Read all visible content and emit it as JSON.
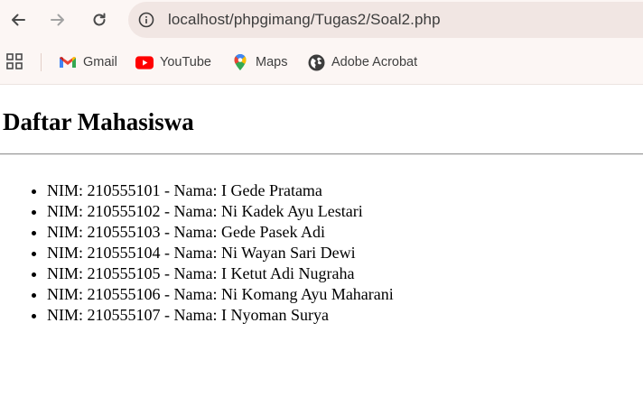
{
  "browser": {
    "url": "localhost/phpgimang/Tugas2/Soal2.php",
    "bookmarks": [
      {
        "label": "Gmail",
        "icon": "gmail-icon"
      },
      {
        "label": "YouTube",
        "icon": "youtube-icon"
      },
      {
        "label": "Maps",
        "icon": "maps-icon"
      },
      {
        "label": "Adobe Acrobat",
        "icon": "globe-icon"
      }
    ]
  },
  "page": {
    "title": "Daftar Mahasiswa",
    "students": [
      "NIM: 210555101 - Nama: I Gede Pratama",
      "NIM: 210555102 - Nama: Ni Kadek Ayu Lestari",
      "NIM: 210555103 - Nama: Gede Pasek Adi",
      "NIM: 210555104 - Nama: Ni Wayan Sari Dewi",
      "NIM: 210555105 - Nama: I Ketut Adi Nugraha",
      "NIM: 210555106 - Nama: Ni Komang Ayu Maharani",
      "NIM: 210555107 - Nama: I Nyoman Surya"
    ]
  },
  "colors": {
    "chrome_bg": "#fcf6f4",
    "omnibox_bg": "#f1e6e3",
    "youtube_red": "#ff0000",
    "gmail_red": "#ea4335"
  }
}
